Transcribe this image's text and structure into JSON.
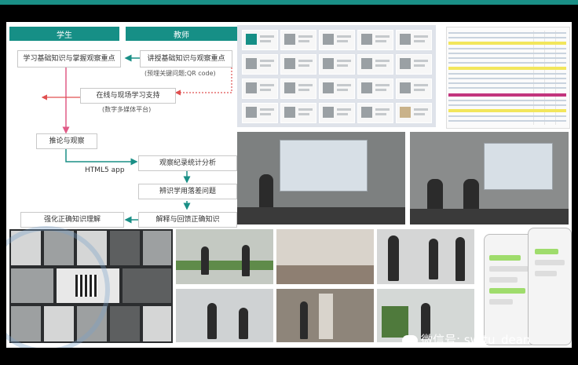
{
  "flowchart": {
    "student_header": "学生",
    "teacher_header": "教师",
    "student_steps": [
      "学习基础知识与掌握观察重点",
      "推论与观察",
      "强化正确知识理解"
    ],
    "teacher_steps": [
      "讲授基础知识与观察重点",
      "观察纪录统计分析",
      "辨识学用落差问题",
      "解释与回馈正确知识"
    ],
    "teacher_note": "(预埋关键问题;QR code)",
    "platform_step": "在线与现场学习支持",
    "platform_note": "(数字多媒体平台)",
    "app_label": "HTML5 app"
  },
  "watermark": {
    "text": "微信号: swjtu_dean"
  },
  "colors": {
    "accent": "#168f86",
    "arrow_teal": "#1a8f86",
    "arrow_pink": "#e05a86",
    "arrow_red_dotted": "#e05050"
  }
}
